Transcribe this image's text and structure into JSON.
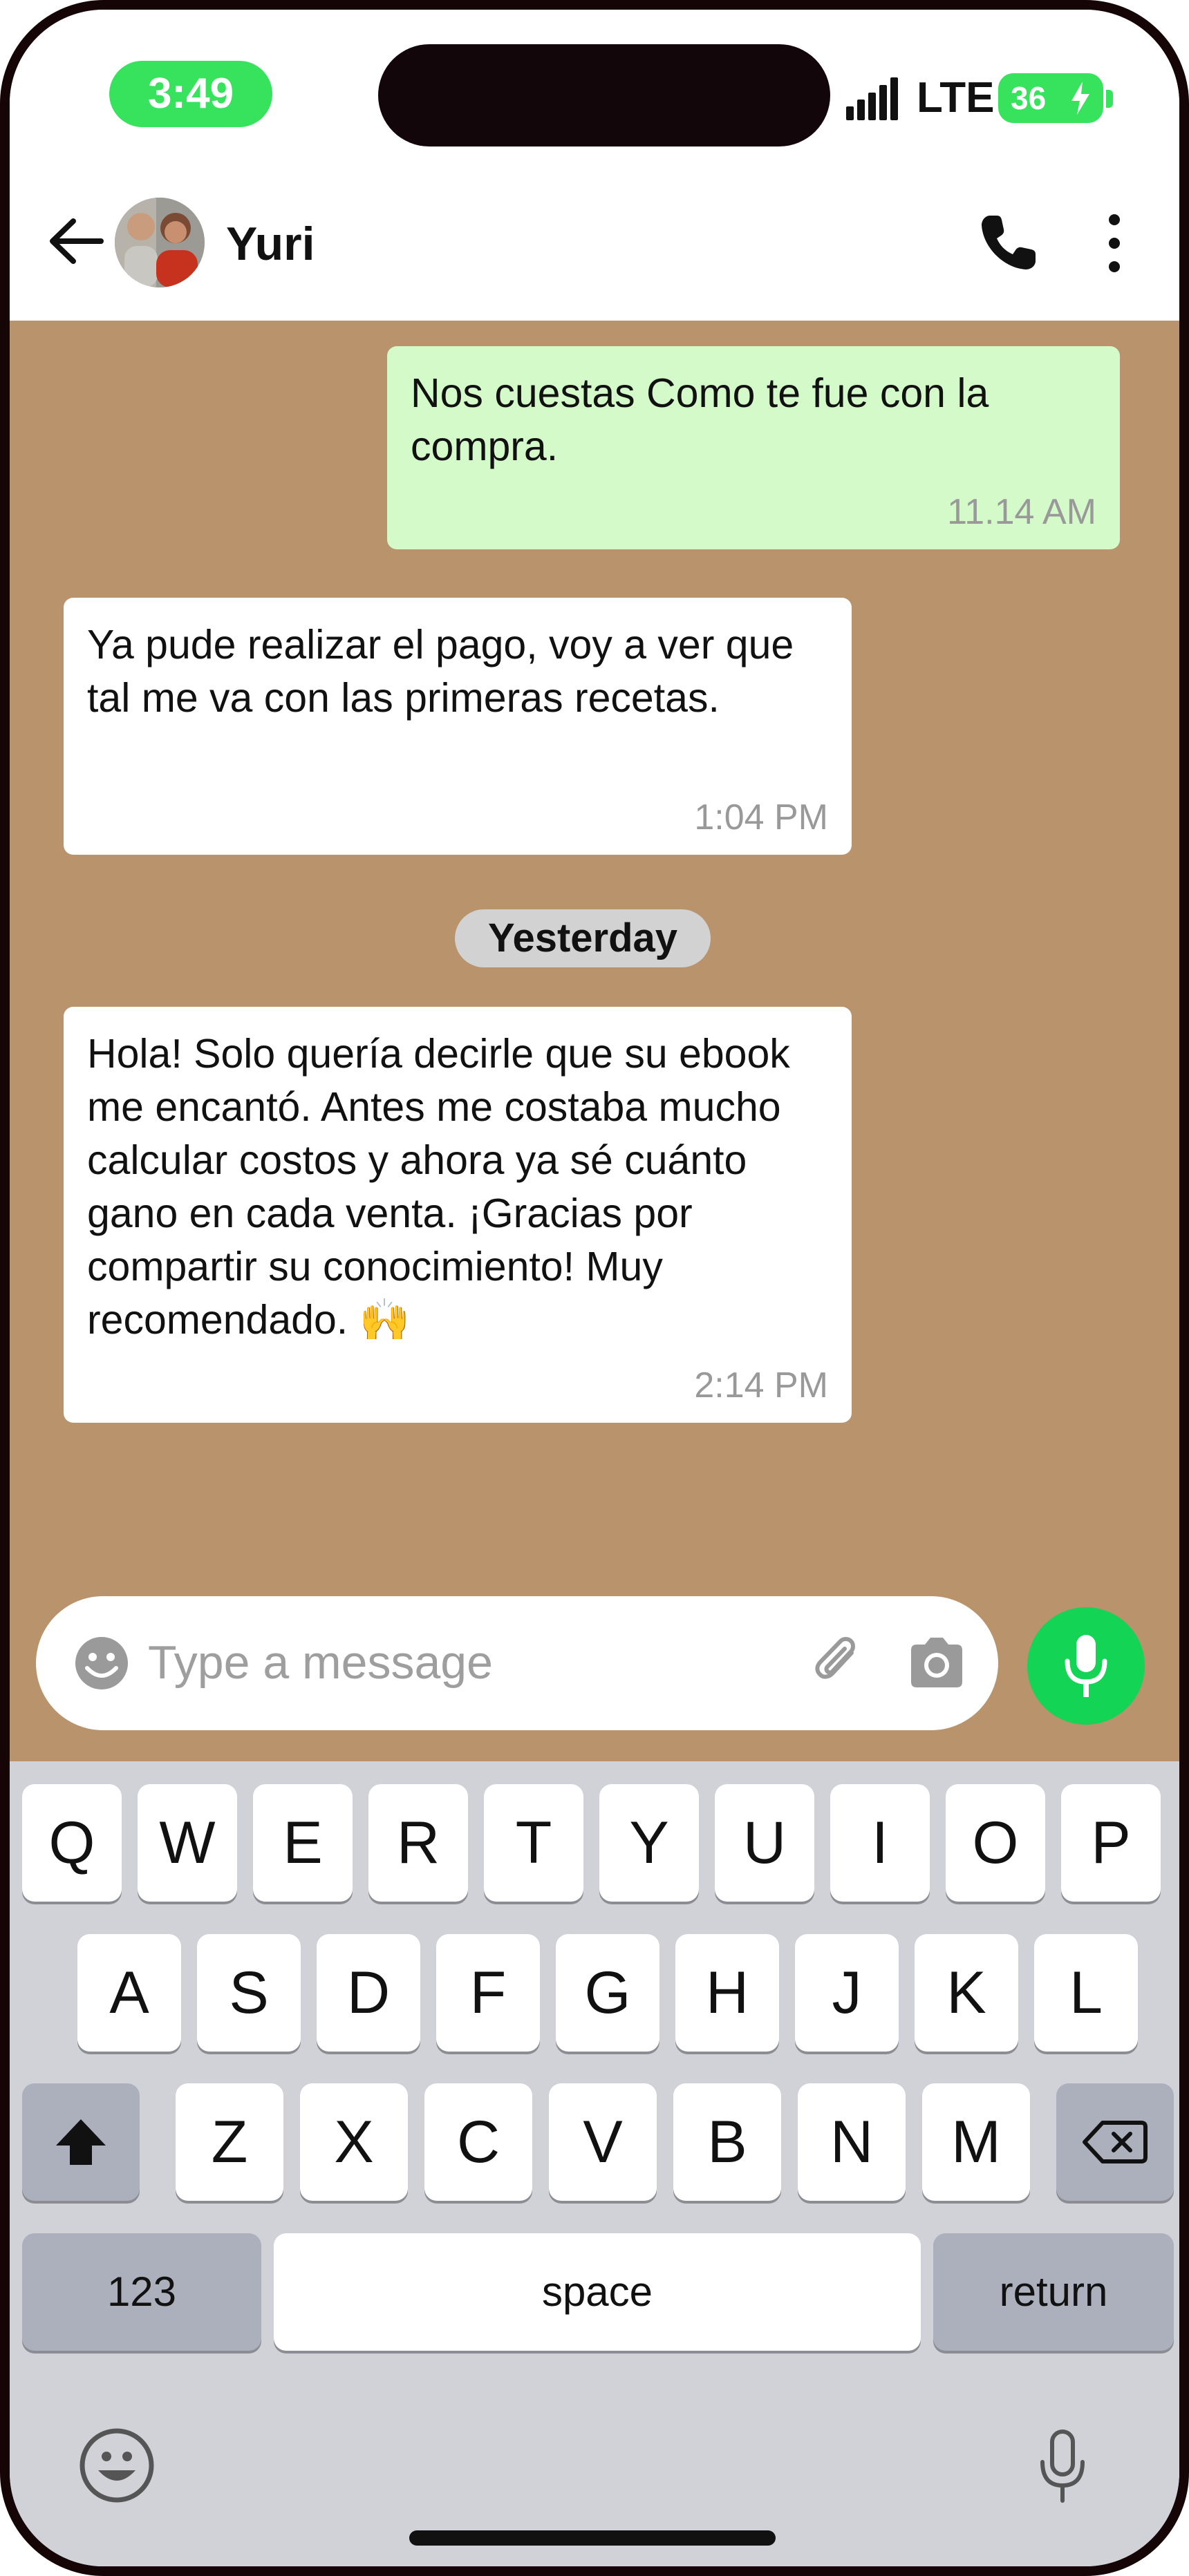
{
  "status_bar": {
    "time": "3:49",
    "network": "LTE",
    "battery": "36",
    "signal_bars": 5
  },
  "header": {
    "contact_name": "Yuri"
  },
  "messages": [
    {
      "direction": "outgoing",
      "text": "Nos cuestas Como te fue con la compra.",
      "time": "11.14 AM"
    },
    {
      "direction": "incoming",
      "text": "Ya pude realizar el pago, voy a ver que tal me va con las primeras recetas.",
      "time": "1:04 PM"
    },
    {
      "direction": "incoming",
      "text": "Hola! Solo quería decirle que su ebook me encantó. Antes me costaba mucho calcular costos y ahora ya sé cuánto gano en cada venta. ¡Gracias por compartir su conocimiento! Muy recomendado. 🙌",
      "time": "2:14 PM"
    }
  ],
  "date_separator": "Yesterday",
  "composer": {
    "placeholder": "Type a message"
  },
  "keyboard": {
    "row1": [
      "Q",
      "W",
      "E",
      "R",
      "T",
      "Y",
      "U",
      "I",
      "O",
      "P"
    ],
    "row2": [
      "A",
      "S",
      "D",
      "F",
      "G",
      "H",
      "J",
      "K",
      "L"
    ],
    "row3": [
      "Z",
      "X",
      "C",
      "V",
      "B",
      "N",
      "M"
    ],
    "numbers_key": "123",
    "space_key": "space",
    "return_key": "return"
  },
  "colors": {
    "chat_background": "#b8936b",
    "outgoing_bubble": "#d3fac8",
    "accent_green": "#13d454",
    "status_green": "#37e35d"
  }
}
